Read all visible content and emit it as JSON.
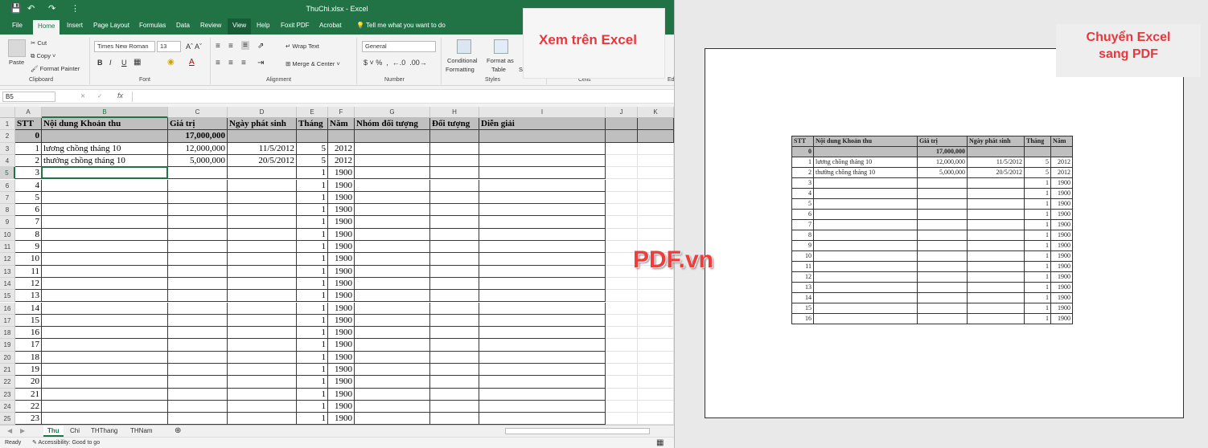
{
  "window": {
    "title": "ThuChi.xlsx  -  Excel",
    "tell_me": "Tell me what you want to do"
  },
  "ribbon_tabs": [
    "File",
    "Home",
    "Insert",
    "Page Layout",
    "Formulas",
    "Data",
    "Review",
    "View",
    "Help",
    "Foxit PDF",
    "Acrobat"
  ],
  "ribbon": {
    "clipboard": {
      "paste": "Paste",
      "cut": "Cut",
      "copy": "Copy",
      "format_painter": "Format Painter",
      "label": "Clipboard"
    },
    "font": {
      "name": "Times New Roman",
      "size": "13",
      "bold": "B",
      "italic": "I",
      "underline": "U",
      "label": "Font"
    },
    "alignment": {
      "wrap": "Wrap Text",
      "merge": "Merge & Center",
      "label": "Alignment"
    },
    "number": {
      "format": "General",
      "label": "Number"
    },
    "styles": {
      "conditional": "Conditional",
      "conditional2": "Formatting",
      "format_as": "Format as",
      "format_as2": "Table",
      "styles_btn": "Styles",
      "label": "Styles"
    },
    "cells": {
      "label": "Cells"
    },
    "editing": {
      "label": "Ed"
    }
  },
  "formula_bar": {
    "name_box": "B5",
    "fx": "fx"
  },
  "columns": [
    "A",
    "B",
    "C",
    "D",
    "E",
    "F",
    "G",
    "H",
    "I",
    "J",
    "K"
  ],
  "rows": [
    "1",
    "2",
    "3",
    "4",
    "5",
    "6",
    "7",
    "8",
    "9",
    "10",
    "11",
    "12",
    "13",
    "14",
    "15",
    "16",
    "17",
    "18",
    "19",
    "20",
    "21",
    "22",
    "23",
    "24",
    "25"
  ],
  "table": {
    "headers": [
      "STT",
      "Nội dung Khoản thu",
      "Giá trị",
      "Ngày phát sinh",
      "Tháng",
      "Năm",
      "Nhóm đối tượng",
      "Đối tượng",
      "Diễn giải"
    ],
    "total_row": [
      "0",
      "",
      "17,000,000",
      "",
      "",
      "",
      "",
      "",
      ""
    ],
    "rows": [
      [
        "1",
        "lương chồng tháng 10",
        "12,000,000",
        "11/5/2012",
        "5",
        "2012"
      ],
      [
        "2",
        "thưởng chồng tháng 10",
        "5,000,000",
        "20/5/2012",
        "5",
        "2012"
      ],
      [
        "3",
        "",
        "",
        "",
        "1",
        "1900"
      ],
      [
        "4",
        "",
        "",
        "",
        "1",
        "1900"
      ],
      [
        "5",
        "",
        "",
        "",
        "1",
        "1900"
      ],
      [
        "6",
        "",
        "",
        "",
        "1",
        "1900"
      ],
      [
        "7",
        "",
        "",
        "",
        "1",
        "1900"
      ],
      [
        "8",
        "",
        "",
        "",
        "1",
        "1900"
      ],
      [
        "9",
        "",
        "",
        "",
        "1",
        "1900"
      ],
      [
        "10",
        "",
        "",
        "",
        "1",
        "1900"
      ],
      [
        "11",
        "",
        "",
        "",
        "1",
        "1900"
      ],
      [
        "12",
        "",
        "",
        "",
        "1",
        "1900"
      ],
      [
        "13",
        "",
        "",
        "",
        "1",
        "1900"
      ],
      [
        "14",
        "",
        "",
        "",
        "1",
        "1900"
      ],
      [
        "15",
        "",
        "",
        "",
        "1",
        "1900"
      ],
      [
        "16",
        "",
        "",
        "",
        "1",
        "1900"
      ],
      [
        "17",
        "",
        "",
        "",
        "1",
        "1900"
      ],
      [
        "18",
        "",
        "",
        "",
        "1",
        "1900"
      ],
      [
        "19",
        "",
        "",
        "",
        "1",
        "1900"
      ],
      [
        "20",
        "",
        "",
        "",
        "1",
        "1900"
      ],
      [
        "21",
        "",
        "",
        "",
        "1",
        "1900"
      ],
      [
        "22",
        "",
        "",
        "",
        "1",
        "1900"
      ],
      [
        "23",
        "",
        "",
        "",
        "1",
        "1900"
      ]
    ]
  },
  "sheet_tabs": [
    "Thu",
    "Chi",
    "THThang",
    "THNam"
  ],
  "status": {
    "ready": "Ready",
    "accessibility": "Accessibility: Good to go"
  },
  "annotations": {
    "excel": "Xem trên Excel",
    "pdf_line1": "Chuyển Excel",
    "pdf_line2": "sang PDF",
    "watermark": "PDF.vn"
  },
  "pdf_table": {
    "headers": [
      "STT",
      "Nội dung Khoản thu",
      "Giá trị",
      "Ngày phát sinh",
      "Tháng",
      "Năm"
    ],
    "total_row": [
      "0",
      "",
      "17,000,000",
      "",
      "",
      ""
    ],
    "rows": [
      [
        "1",
        "lương chồng tháng 10",
        "12,000,000",
        "11/5/2012",
        "5",
        "2012"
      ],
      [
        "2",
        "thưởng chồng tháng 10",
        "5,000,000",
        "20/5/2012",
        "5",
        "2012"
      ],
      [
        "3",
        "",
        "",
        "",
        "1",
        "1900"
      ],
      [
        "4",
        "",
        "",
        "",
        "1",
        "1900"
      ],
      [
        "5",
        "",
        "",
        "",
        "1",
        "1900"
      ],
      [
        "6",
        "",
        "",
        "",
        "1",
        "1900"
      ],
      [
        "7",
        "",
        "",
        "",
        "1",
        "1900"
      ],
      [
        "8",
        "",
        "",
        "",
        "1",
        "1900"
      ],
      [
        "9",
        "",
        "",
        "",
        "1",
        "1900"
      ],
      [
        "10",
        "",
        "",
        "",
        "1",
        "1900"
      ],
      [
        "11",
        "",
        "",
        "",
        "1",
        "1900"
      ],
      [
        "12",
        "",
        "",
        "",
        "1",
        "1900"
      ],
      [
        "13",
        "",
        "",
        "",
        "1",
        "1900"
      ],
      [
        "14",
        "",
        "",
        "",
        "1",
        "1900"
      ],
      [
        "15",
        "",
        "",
        "",
        "1",
        "1900"
      ],
      [
        "16",
        "",
        "",
        "",
        "1",
        "1900"
      ]
    ]
  }
}
